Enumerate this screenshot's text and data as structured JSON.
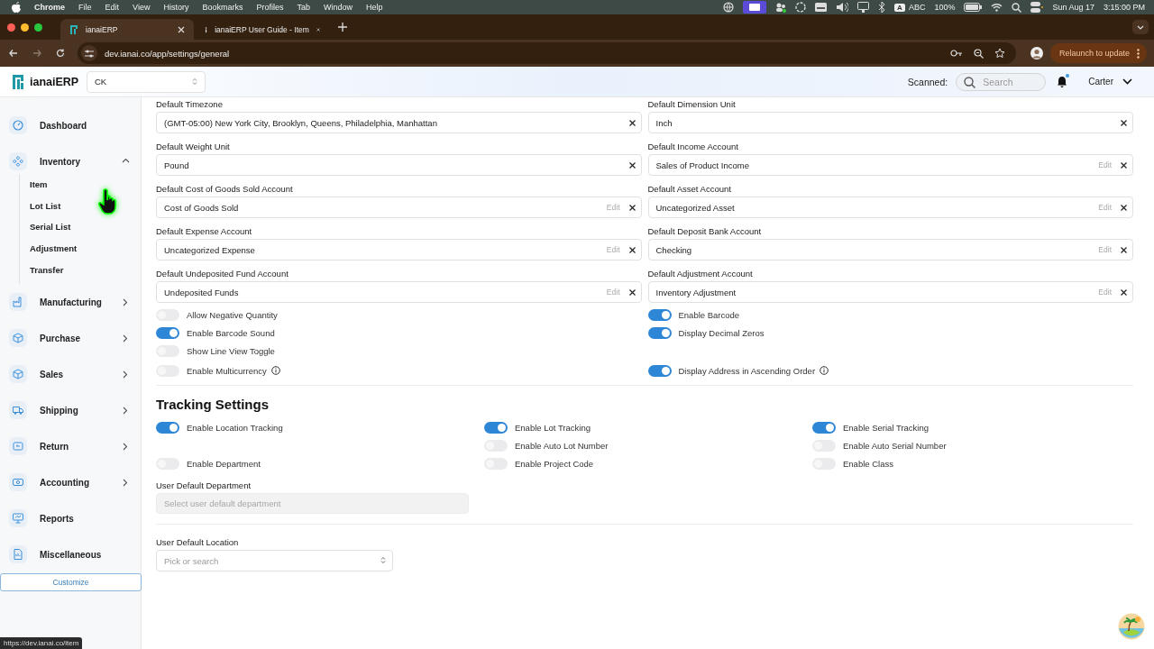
{
  "menubar": {
    "app": "Chrome",
    "menus": [
      "File",
      "Edit",
      "View",
      "History",
      "Bookmarks",
      "Profiles",
      "Tab",
      "Window",
      "Help"
    ],
    "input_letter": "A",
    "input_source": "ABC",
    "battery": "100%",
    "date": "Sun Aug 17",
    "time": "3:15:00 PM"
  },
  "browser": {
    "tabs": [
      {
        "title": "ianaiERP",
        "selected": true
      },
      {
        "title": "ianaiERP User Guide - Item",
        "selected": false
      }
    ],
    "url": "dev.ianai.co/app/settings/general",
    "relaunch": "Relaunch to update",
    "status_url": "https://dev.ianai.co/item"
  },
  "header": {
    "app_name": "ianaiERP",
    "company": "CK",
    "scanned_label": "Scanned:",
    "search_placeholder": "Search",
    "unread": true,
    "user": "Carter"
  },
  "sidebar": {
    "items": [
      {
        "label": "Dashboard",
        "kind": "link"
      },
      {
        "label": "Inventory",
        "kind": "group",
        "expanded": true,
        "children": [
          {
            "label": "Item"
          },
          {
            "label": "Lot List"
          },
          {
            "label": "Serial List"
          },
          {
            "label": "Adjustment"
          },
          {
            "label": "Transfer"
          }
        ]
      },
      {
        "label": "Manufacturing",
        "kind": "group",
        "expanded": false
      },
      {
        "label": "Purchase",
        "kind": "group",
        "expanded": false
      },
      {
        "label": "Sales",
        "kind": "group",
        "expanded": false
      },
      {
        "label": "Shipping",
        "kind": "group",
        "expanded": false
      },
      {
        "label": "Return",
        "kind": "group",
        "expanded": false
      },
      {
        "label": "Accounting",
        "kind": "group",
        "expanded": false
      },
      {
        "label": "Reports",
        "kind": "link"
      },
      {
        "label": "Miscellaneous",
        "kind": "link"
      }
    ],
    "customize": "Customize"
  },
  "defaults": [
    {
      "label": "Default Timezone",
      "value": "(GMT-05:00) New York City, Brooklyn, Queens, Philadelphia, Manhattan"
    },
    {
      "label": "Default Dimension Unit",
      "value": "Inch"
    },
    {
      "label": "Default Weight Unit",
      "value": "Pound"
    },
    {
      "label": "Default Income Account",
      "value": "Sales of Product Income",
      "edit": "Edit"
    },
    {
      "label": "Default Cost of Goods Sold Account",
      "value": "Cost of Goods Sold",
      "edit": "Edit"
    },
    {
      "label": "Default Asset Account",
      "value": "Uncategorized Asset",
      "edit": "Edit"
    },
    {
      "label": "Default Expense Account",
      "value": "Uncategorized Expense",
      "edit": "Edit"
    },
    {
      "label": "Default Deposit Bank Account",
      "value": "Checking",
      "edit": "Edit"
    },
    {
      "label": "Default Undeposited Fund Account",
      "value": "Undeposited Funds",
      "edit": "Edit"
    },
    {
      "label": "Default Adjustment Account",
      "value": "Inventory Adjustment",
      "edit": "Edit"
    }
  ],
  "option_rows": [
    {
      "left": {
        "label": "Allow Negative Quantity",
        "on": false,
        "info": false
      },
      "right": {
        "label": "Enable Barcode",
        "on": true,
        "info": false
      }
    },
    {
      "left": {
        "label": "Enable Barcode Sound",
        "on": true,
        "info": false
      },
      "right": {
        "label": "Display Decimal Zeros",
        "on": true,
        "info": false
      }
    },
    {
      "left": {
        "label": "Show Line View Toggle",
        "on": false,
        "info": false
      }
    },
    {
      "left": {
        "label": "Enable Multicurrency",
        "on": false,
        "info": true
      },
      "right": {
        "label": "Display Address in Ascending Order",
        "on": true,
        "info": true
      }
    }
  ],
  "tracking": {
    "title": "Tracking Settings",
    "rows": [
      [
        {
          "label": "Enable Location Tracking",
          "on": true
        },
        {
          "label": "Enable Lot Tracking",
          "on": true
        },
        {
          "label": "Enable Serial Tracking",
          "on": true
        }
      ],
      [
        null,
        {
          "label": "Enable Auto Lot Number",
          "on": false
        },
        {
          "label": "Enable Auto Serial Number",
          "on": false
        }
      ],
      [
        {
          "label": "Enable Department",
          "on": false
        },
        {
          "label": "Enable Project Code",
          "on": false
        },
        {
          "label": "Enable Class",
          "on": false
        }
      ]
    ]
  },
  "department": {
    "label": "User Default Department",
    "placeholder": "Select user default department",
    "disabled": true
  },
  "location": {
    "label": "User Default Location",
    "placeholder": "Pick or search"
  }
}
